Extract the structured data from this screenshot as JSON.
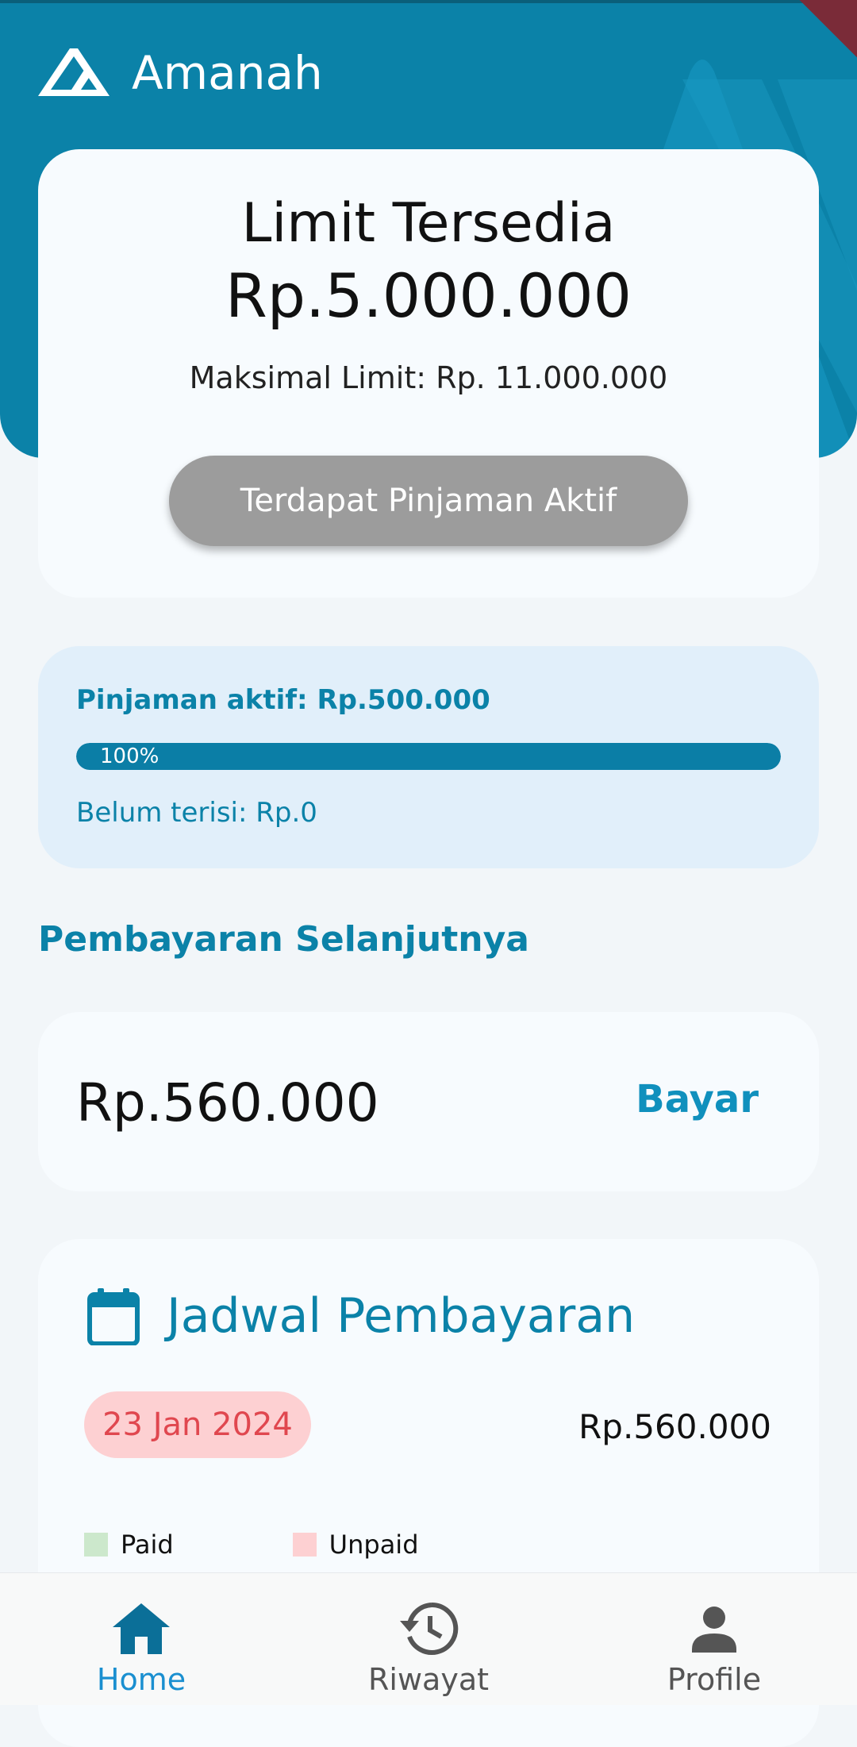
{
  "app": {
    "name": "Amanah"
  },
  "colors": {
    "primary": "#0b82a8",
    "unpaid": "#fdd0d2",
    "paid": "#cce8cc",
    "disabled_button": "#9c9c9c"
  },
  "limit_card": {
    "title": "Limit Tersedia",
    "amount": "Rp.5.000.000",
    "max_limit": "Maksimal Limit: Rp. 11.000.000",
    "button_label": "Terdapat Pinjaman Aktif"
  },
  "loan_card": {
    "active_label": "Pinjaman aktif: Rp.500.000",
    "progress_percent": 100,
    "progress_label": "100%",
    "unfilled_label": "Belum terisi: Rp.0"
  },
  "next_payment": {
    "section_title": "Pembayaran Selanjutnya",
    "amount": "Rp.560.000",
    "pay_label": "Bayar"
  },
  "schedule": {
    "title": "Jadwal Pembayaran",
    "icon": "calendar-icon",
    "entries": [
      {
        "date": "23 Jan 2024",
        "amount": "Rp.560.000",
        "status": "unpaid"
      }
    ],
    "legend": [
      {
        "label": "Paid",
        "color": "#cce8cc"
      },
      {
        "label": "Unpaid",
        "color": "#fdd0d2"
      }
    ]
  },
  "bottom_nav": {
    "items": [
      {
        "label": "Home",
        "icon": "home-icon",
        "active": true
      },
      {
        "label": "Riwayat",
        "icon": "history-icon",
        "active": false
      },
      {
        "label": "Profile",
        "icon": "person-icon",
        "active": false
      }
    ]
  }
}
